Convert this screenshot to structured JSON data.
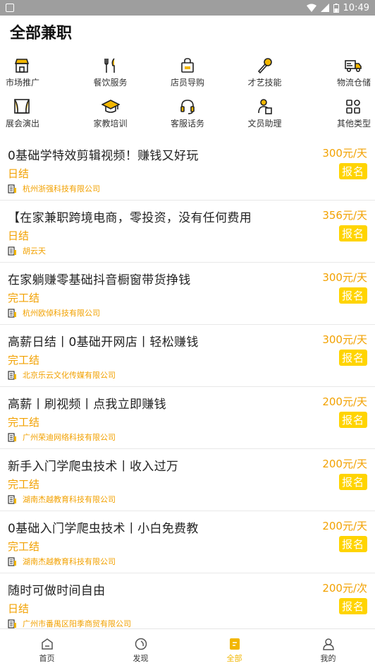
{
  "statusbar": {
    "time": "10:49"
  },
  "header": {
    "title": "全部兼职"
  },
  "categories": [
    {
      "label": "市场推广",
      "icon": "shop-icon"
    },
    {
      "label": "餐饮服务",
      "icon": "fork-knife-icon"
    },
    {
      "label": "店员导购",
      "icon": "shopping-bag-icon"
    },
    {
      "label": "才艺技能",
      "icon": "microphone-icon"
    },
    {
      "label": "物流仓储",
      "icon": "truck-icon"
    },
    {
      "label": "展会演出",
      "icon": "stage-icon"
    },
    {
      "label": "家教培训",
      "icon": "graduation-cap-icon"
    },
    {
      "label": "客服话务",
      "icon": "headset-icon"
    },
    {
      "label": "文员助理",
      "icon": "clerk-icon"
    },
    {
      "label": "其他类型",
      "icon": "grid-icon"
    }
  ],
  "jobs": [
    {
      "title": "0基础学特效剪辑视频！赚钱又好玩",
      "pay_type": "日结",
      "company": "杭州浙强科技有限公司",
      "salary": "300元/天",
      "apply": "报名"
    },
    {
      "title": "【在家兼职跨境电商，零投资，没有任何费用",
      "pay_type": "日结",
      "company": "胡云天",
      "salary": "356元/天",
      "apply": "报名"
    },
    {
      "title": "在家躺赚零基础抖音橱窗带货挣钱",
      "pay_type": "完工结",
      "company": "杭州欧倬科技有限公司",
      "salary": "300元/天",
      "apply": "报名"
    },
    {
      "title": "高薪日结丨0基础开网店丨轻松赚钱",
      "pay_type": "完工结",
      "company": "北京乐云文化传媒有限公司",
      "salary": "300元/天",
      "apply": "报名"
    },
    {
      "title": "高薪丨刷视频丨点我立即赚钱",
      "pay_type": "完工结",
      "company": "广州荣迪网络科技有限公司",
      "salary": "200元/天",
      "apply": "报名"
    },
    {
      "title": "新手入门学爬虫技术丨收入过万",
      "pay_type": "完工结",
      "company": "湖南杰越教育科技有限公司",
      "salary": "200元/天",
      "apply": "报名"
    },
    {
      "title": "0基础入门学爬虫技术丨小白免费教",
      "pay_type": "完工结",
      "company": "湖南杰越教育科技有限公司",
      "salary": "200元/天",
      "apply": "报名"
    },
    {
      "title": "随时可做时间自由",
      "pay_type": "日结",
      "company": "广州市番禺区阳季商贸有限公司",
      "salary": "200元/次",
      "apply": "报名"
    }
  ],
  "tabbar": {
    "home": "首页",
    "discover": "发现",
    "all": "全部",
    "mine": "我的"
  },
  "colors": {
    "accent": "#f2a100",
    "badge": "#ffd400",
    "statusbar": "#9e9e9e"
  }
}
